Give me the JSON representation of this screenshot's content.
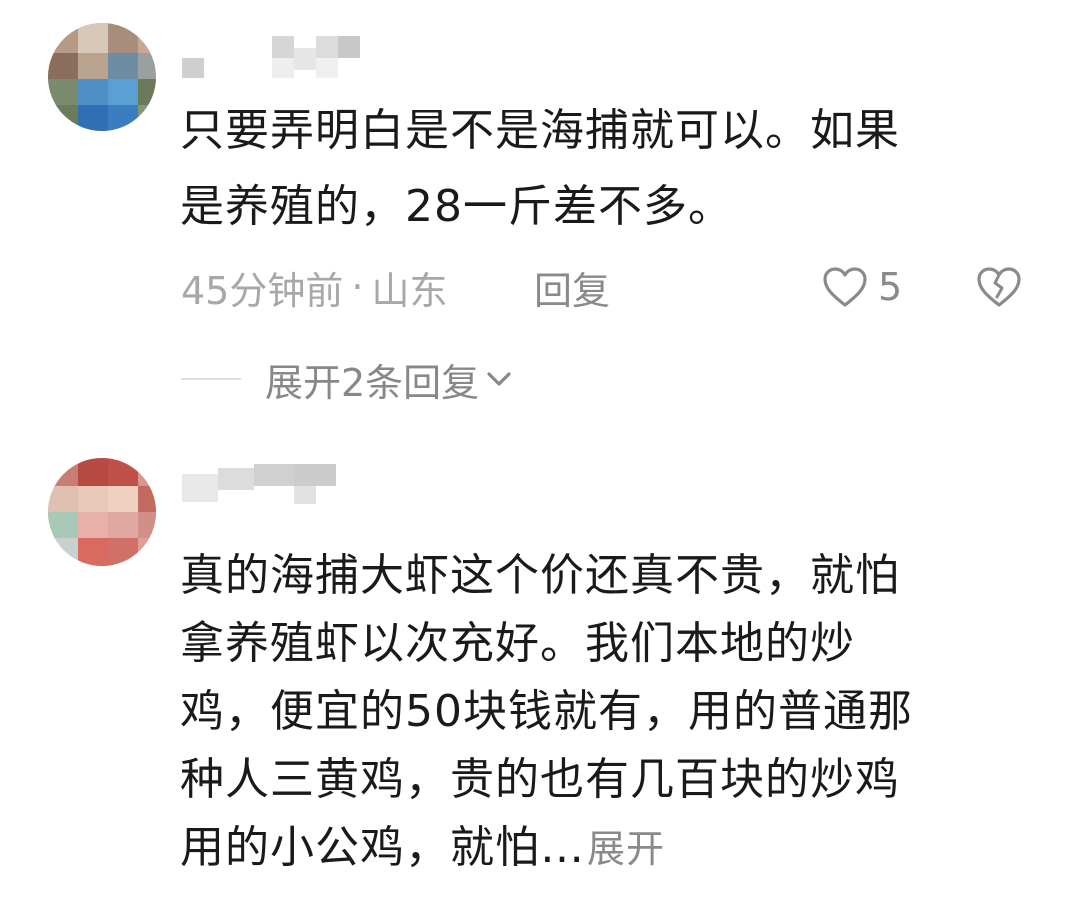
{
  "comments": [
    {
      "text_lines": [
        "只要弄明白是不是海捕就可以。如果",
        "是养殖的，28一斤差不多。"
      ],
      "time": "45分钟前",
      "separator": "·",
      "location": "山东",
      "reply_label": "回复",
      "like_count": "5",
      "expand_replies_label": "展开2条回复",
      "avatar_icon": "user-avatar",
      "like_icon": "heart-outline-icon",
      "dislike_icon": "broken-heart-icon",
      "expand_icon": "chevron-down-icon"
    },
    {
      "text_lines": [
        "真的海捕大虾这个价还真不贵，就怕",
        "拿养殖虾以次充好。我们本地的炒",
        "鸡，便宜的50块钱就有，用的普通那",
        "种人三黄鸡，贵的也有几百块的炒鸡",
        "用的小公鸡，就怕…"
      ],
      "more_label": "展开",
      "avatar_icon": "user-avatar"
    }
  ],
  "colors": {
    "text": "#1a1a1a",
    "meta": "#a8a8a8",
    "action": "#8a8a8a"
  }
}
